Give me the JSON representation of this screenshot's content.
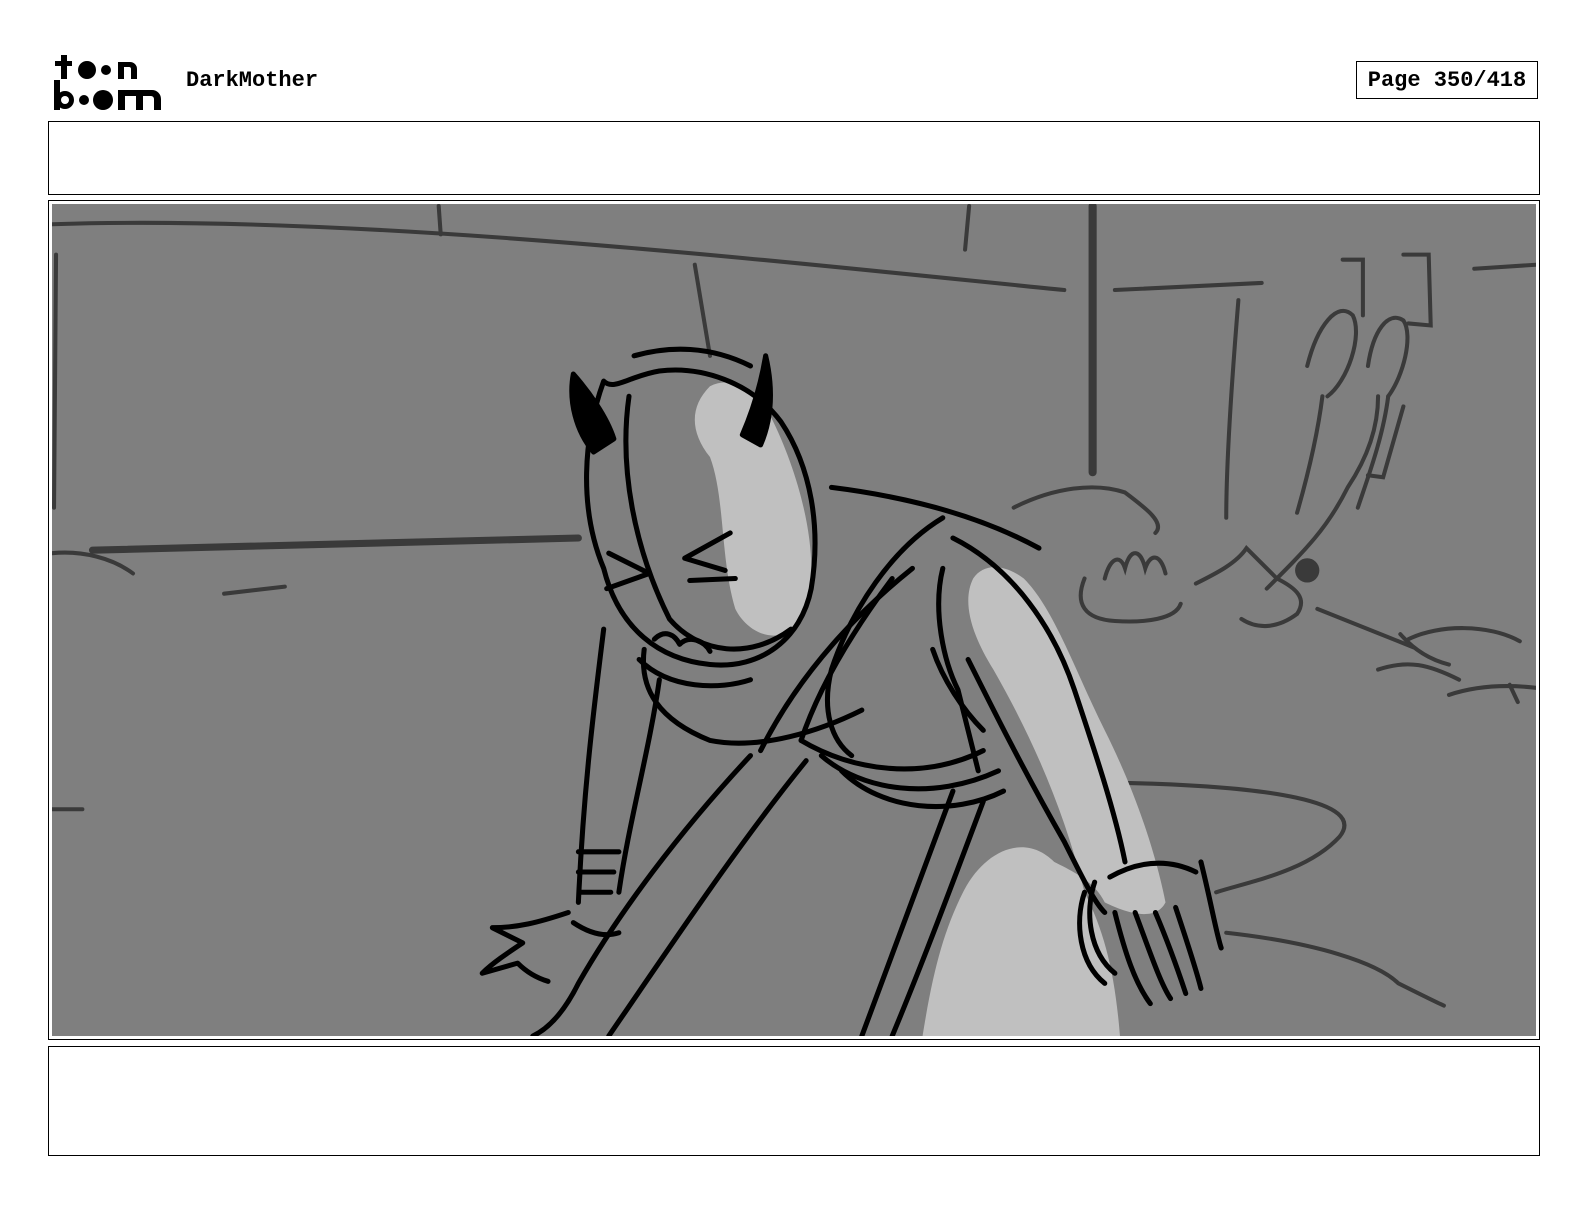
{
  "header": {
    "project_title": "DarkMother",
    "page_label": "Page 350/418"
  },
  "logo": {
    "name": "toon-boom-logo",
    "line1": "toon",
    "line2": "boom"
  },
  "panel": {
    "action_notes": "",
    "dialogue_notes": ""
  },
  "colors": {
    "frame_background": "#7f7f7f",
    "highlight": "#c0c0c0",
    "ink": "#000000",
    "background_lines": "#3a3a3a"
  }
}
